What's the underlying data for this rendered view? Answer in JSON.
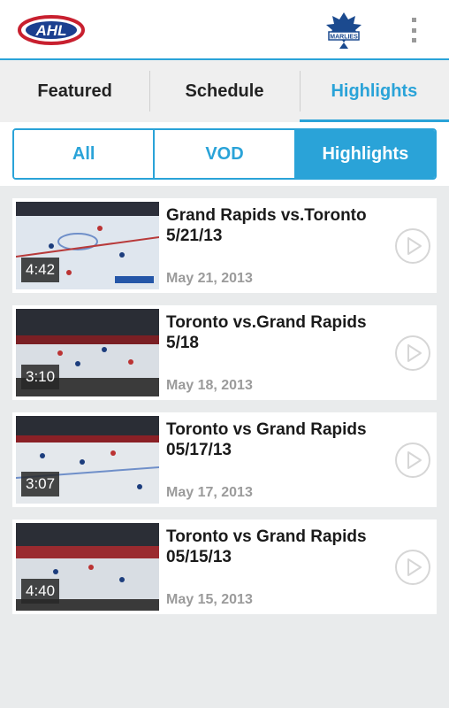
{
  "colors": {
    "accent": "#2aa3d8",
    "card_bg": "#ffffff",
    "page_bg": "#e9ebec",
    "muted_text": "#9b9b9b"
  },
  "app_bar": {
    "logo_text": "AHL",
    "team_logo_text": "MARLIES",
    "overflow_icon": "overflow-menu-icon"
  },
  "tabs": [
    {
      "label": "Featured",
      "active": false
    },
    {
      "label": "Schedule",
      "active": false
    },
    {
      "label": "Highlights",
      "active": true
    }
  ],
  "filters": [
    {
      "label": "All",
      "active": false
    },
    {
      "label": "VOD",
      "active": false
    },
    {
      "label": "Highlights",
      "active": true
    }
  ],
  "videos": [
    {
      "title": "Grand Rapids vs.Toronto 5/21/13",
      "date": "May 21, 2013",
      "duration": "4:42"
    },
    {
      "title": "Toronto vs.Grand Rapids 5/18",
      "date": "May 18, 2013",
      "duration": "3:10"
    },
    {
      "title": "Toronto vs Grand Rapids 05/17/13",
      "date": "May 17, 2013",
      "duration": "3:07"
    },
    {
      "title": "Toronto vs Grand Rapids 05/15/13",
      "date": "May 15, 2013",
      "duration": "4:40"
    }
  ]
}
